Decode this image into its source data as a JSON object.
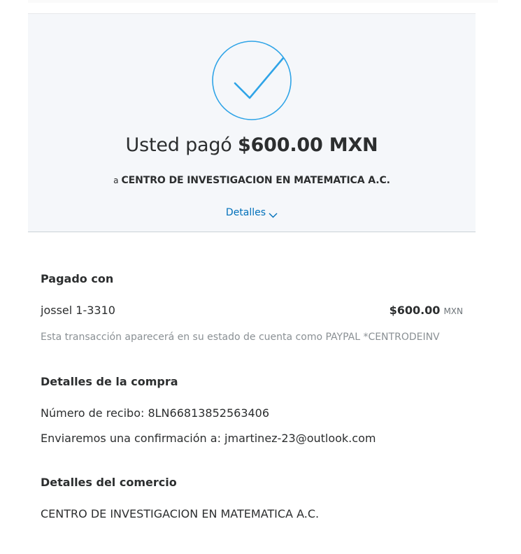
{
  "header": {
    "icon": "checkmark-circle-icon",
    "paid_prefix": "Usted pagó",
    "paid_amount": "$600.00 MXN",
    "to_prefix": "a",
    "merchant": "CENTRO DE INVESTIGACION EN MATEMATICA A.C.",
    "details_label": "Detalles"
  },
  "payment": {
    "title": "Pagado con",
    "method": "jossel 1-3310",
    "amount": "$600.00",
    "currency": "MXN",
    "statement_note": "Esta transacción aparecerá en su estado de cuenta como PAYPAL *CENTRODEINV"
  },
  "purchase": {
    "title": "Detalles de la compra",
    "receipt": "Número de recibo: 8LN66813852563406",
    "confirmation": "Enviaremos una confirmación a: jmartinez-23@outlook.com"
  },
  "merchant_details": {
    "title": "Detalles del comercio",
    "name": "CENTRO DE INVESTIGACION EN MATEMATICA A.C."
  },
  "colors": {
    "accent": "#0070ba",
    "check": "#2fa4e7",
    "hero_bg": "#f5f7fa"
  }
}
